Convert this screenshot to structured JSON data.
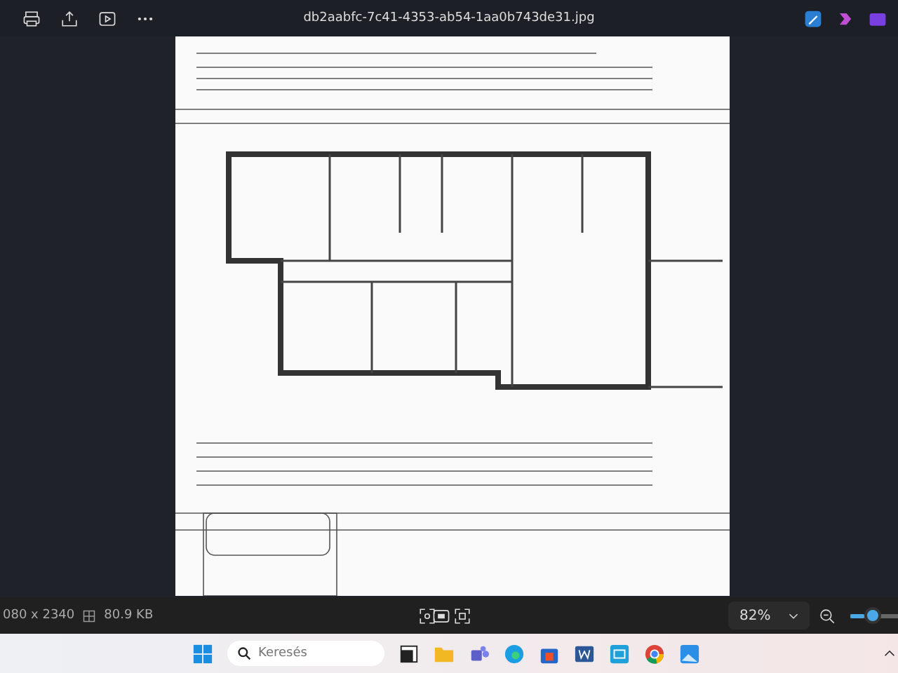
{
  "window": {
    "title": "db2aabfc-7c41-4353-ab54-1aa0b743de31.jpg"
  },
  "status_bar": {
    "dimensions": "080 x 2340",
    "file_size": "80.9 KB",
    "zoom": "82%",
    "zoom_slider": {
      "level": 0.3
    }
  },
  "taskbar": {
    "search": {
      "placeholder": "Keresés"
    }
  }
}
